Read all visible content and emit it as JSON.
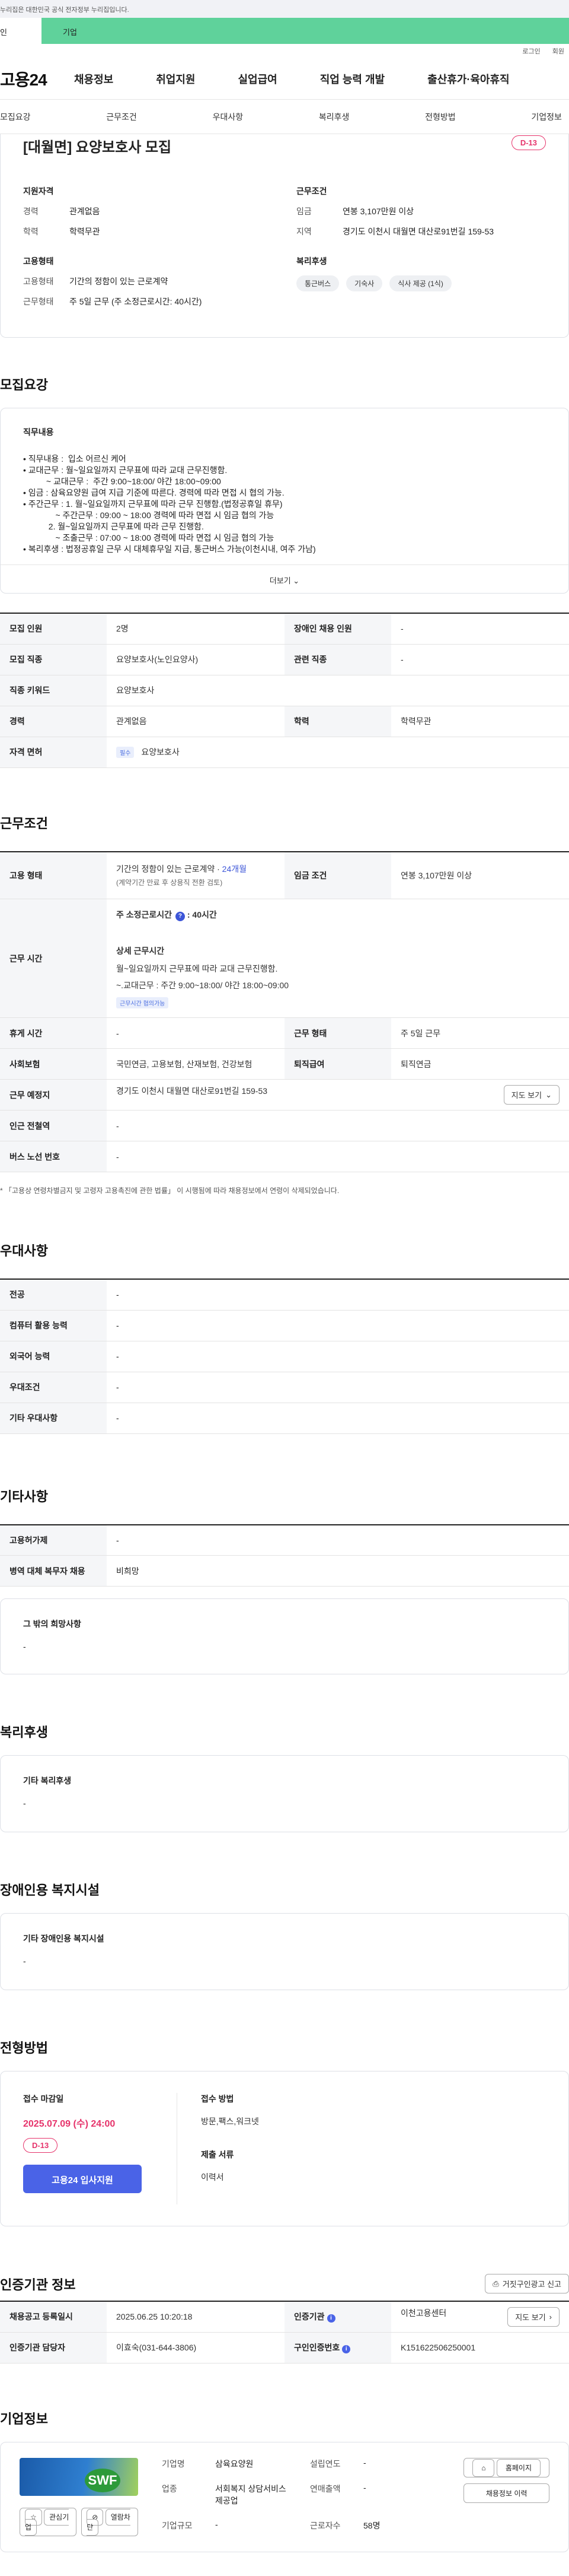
{
  "gov_bar": "누리집은 대한민국 공식 전자정부 누리집입니다.",
  "top_tabs": {
    "personal": "인",
    "company": "기업"
  },
  "util": {
    "login": "로그인",
    "join": "회원"
  },
  "logo": "고용24",
  "gnb": [
    "채용정보",
    "취업지원",
    "실업급여",
    "직업 능력 개발",
    "출산휴가·육아휴직"
  ],
  "subnav": [
    "모집요강",
    "근무조건",
    "우대사항",
    "복리후생",
    "전형방법",
    "기업정보"
  ],
  "summary": {
    "title": "[대월면] 요양보호사 모집",
    "dday": "D-13",
    "qual_head": "지원자격",
    "career_k": "경력",
    "career_v": "관계없음",
    "edu_k": "학력",
    "edu_v": "학력무관",
    "cond_head": "근무조건",
    "wage_k": "임금",
    "wage_v": "연봉 3,107만원 이상",
    "area_k": "지역",
    "area_v": "경기도 이천시 대월면 대산로91번길 159-53",
    "emp_head": "고용형태",
    "emptype_k": "고용형태",
    "emptype_v": "기간의 정함이 있는 근로계약",
    "worktype_k": "근무형태",
    "worktype_v": "주 5일 근무 (주 소정근로시간: 40시간)",
    "welfare_head": "복리후생",
    "chips": [
      "통근버스",
      "기숙사",
      "식사 제공 (1식)"
    ]
  },
  "recruit": {
    "section": "모집요강",
    "head": "직무내용",
    "text": "• 직무내용 :  입소 어르신 케어\n• 교대근무 : 월~일요일까지 근무표에 따라 교대 근무진행함.\n          ~ 교대근무 :  주간 9:00~18:00/ 야간 18:00~09:00\n• 임금 : 삼육요양원 급여 지급 기준에 따른다. 경력에 따라 면접 시 협의 가능.\n• 주간근무 : 1. 월~일요일까지 근무표에 따라 근무 진행함.(법정공휴일 휴무)\n              ~ 주간근무 : 09:00 ~ 18:00 경력에 따라 면접 시 임금 협의 가능\n           2. 월~일요일까지 근무표에 따라 근무 진행함.\n              ~ 조출근무 : 07:00 ~ 18:00 경력에 따라 면접 시 임금 협의 가능\n• 복리후생 : 법정공휴일 근무 시 대체휴무일 지급, 통근버스 가능(이천시내, 여주 가남)",
    "more": "더보기",
    "rows": [
      {
        "k1": "모집 인원",
        "v1": "2명",
        "k2": "장애인 채용 인원",
        "v2": "-"
      },
      {
        "k1": "모집 직종",
        "v1": "요양보호사(노인요양사)",
        "k2": "관련 직종",
        "v2": "-"
      },
      {
        "k1": "직종 키워드",
        "v1": "요양보호사"
      },
      {
        "k1": "경력",
        "v1": "관계없음",
        "k2": "학력",
        "v2": "학력무관"
      },
      {
        "k1": "자격 면허",
        "tag": "필수",
        "v1": "요양보호사"
      }
    ]
  },
  "conditions": {
    "section": "근무조건",
    "emp_k": "고용 형태",
    "emp_v1": "기간의 정함이 있는 근로계약 · ",
    "emp_v1b": "24개월",
    "emp_v2": "(계약기간 만료 후 상용직 전환 검토)",
    "wage_k": "임금 조건",
    "wage_v": "연봉 3,107만원 이상",
    "time_k": "근무 시간",
    "time_main": "주 소정근로시간",
    "time_hours": "40시간",
    "time_detail_head": "상세 근무시간",
    "time_detail1": "월~일요일까지 근무표에 따라 교대 근무진행함.",
    "time_detail2": "~.교대근무 :  주간 9:00~18:00/ 야간 18:00~09:00",
    "time_tag": "근무시간 협의가능",
    "rest_k": "휴게 시간",
    "rest_v": "-",
    "form_k": "근무 형태",
    "form_v": "주 5일 근무",
    "ins_k": "사회보험",
    "ins_v": "국민연금, 고용보험, 산재보험, 건강보험",
    "ret_k": "퇴직급여",
    "ret_v": "퇴직연금",
    "place_k": "근무 예정지",
    "place_v": "경기도 이천시 대월면 대산로91번길 159-53",
    "map_btn": "지도 보기",
    "subway_k": "인근 전철역",
    "subway_v": "-",
    "bus_k": "버스 노선 번호",
    "bus_v": "-",
    "note": "* 「고용상 연령차별금지 및 고령자 고용촉진에 관한 법률」 이 시행됨에 따라 채용정보에서 연령이 삭제되었습니다."
  },
  "prefer": {
    "section": "우대사항",
    "rows": [
      {
        "k": "전공",
        "v": "-"
      },
      {
        "k": "컴퓨터 활용 능력",
        "v": "-"
      },
      {
        "k": "외국어 능력",
        "v": "-"
      },
      {
        "k": "우대조건",
        "v": "-"
      },
      {
        "k": "기타 우대사항",
        "v": "-"
      }
    ]
  },
  "etc": {
    "section": "기타사항",
    "rows": [
      {
        "k": "고용허가제",
        "v": "-"
      },
      {
        "k": "병역 대체 복무자 채용",
        "v": "비희망"
      }
    ],
    "hope_head": "그 밖의 희망사항",
    "hope_v": "-"
  },
  "welfare": {
    "section": "복리후생",
    "head": "기타 복리후생",
    "v": "-"
  },
  "disabled": {
    "section": "장애인용 복지시설",
    "head": "기타 장애인용 복지시설",
    "v": "-"
  },
  "method": {
    "section": "전형방법",
    "deadline_head": "접수 마감일",
    "deadline": "2025.07.09 (수) 24:00",
    "dday": "D-13",
    "apply": "고용24 입사지원",
    "way_head": "접수 방법",
    "way_v": "방문,팩스,워크넷",
    "docs_head": "제출 서류",
    "docs_v": "이력서"
  },
  "agency": {
    "section": "인증기관 정보",
    "report_btn": "거짓구인광고 신고",
    "reg_k": "채용공고 등록일시",
    "reg_v": "2025.06.25 10:20:18",
    "org_k": "인증기관",
    "org_v": "이천고용센터",
    "map_btn": "지도 보기",
    "mgr_k": "인증기관 담당자",
    "mgr_v": "이효숙(031-644-3806)",
    "num_k": "구인인증번호",
    "num_v": "K151622506250001"
  },
  "company": {
    "section": "기업정보",
    "logo_text": "SWF",
    "fav_btn": "관심기업",
    "block_btn": "열람차단",
    "name_k": "기업명",
    "name_v": "삼육요양원",
    "ind_k": "업종",
    "ind_v": "서회복지 상담서비스 제공업",
    "year_k": "설립연도",
    "year_v": "-",
    "sales_k": "연매출액",
    "sales_v": "-",
    "emp_k": "근로자수",
    "emp_v": "58명",
    "size_k": "기업규모",
    "size_v": "-",
    "home_btn": "홈페이지",
    "jobs_btn": "채용정보 이력"
  }
}
